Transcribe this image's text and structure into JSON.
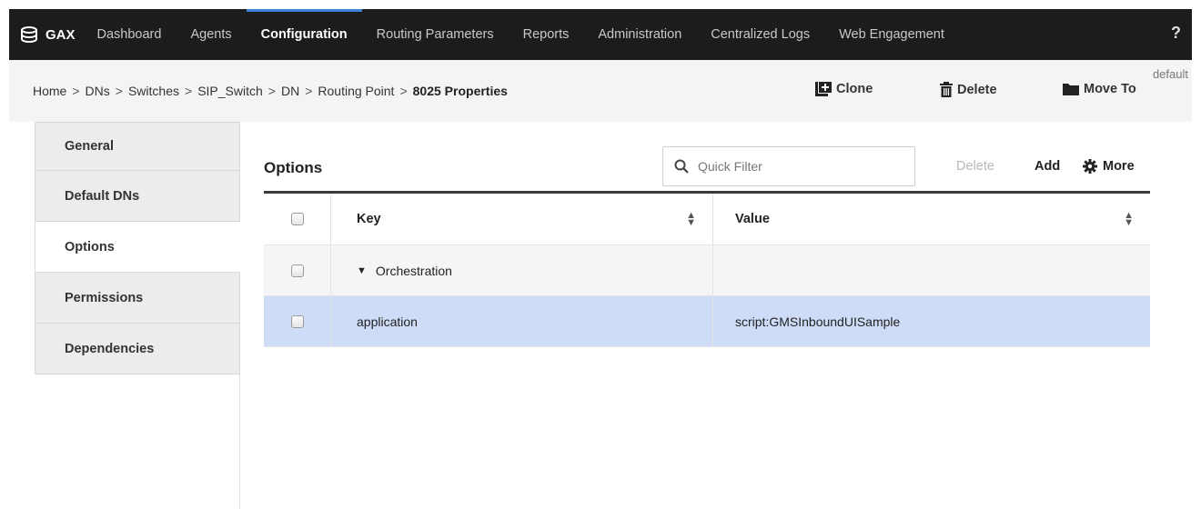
{
  "nav": {
    "brand": "GAX",
    "items": [
      {
        "label": "Dashboard"
      },
      {
        "label": "Agents"
      },
      {
        "label": "Configuration"
      },
      {
        "label": "Routing Parameters"
      },
      {
        "label": "Reports"
      },
      {
        "label": "Administration"
      },
      {
        "label": "Centralized Logs"
      },
      {
        "label": "Web Engagement"
      }
    ],
    "active": "Configuration",
    "help": "?"
  },
  "breadcrumb": {
    "items": [
      "Home",
      "DNs",
      "Switches",
      "SIP_Switch",
      "DN",
      "Routing Point",
      "8025 Properties"
    ],
    "separator": ">"
  },
  "tenant": "default",
  "actions": {
    "clone": "Clone",
    "delete": "Delete",
    "move_to": "Move To"
  },
  "tabs": [
    {
      "label": "General"
    },
    {
      "label": "Default DNs"
    },
    {
      "label": "Options"
    },
    {
      "label": "Permissions"
    },
    {
      "label": "Dependencies"
    }
  ],
  "active_tab": "Options",
  "options": {
    "title": "Options",
    "filter_placeholder": "Quick Filter",
    "delete_label": "Delete",
    "add_label": "Add",
    "more_label": "More",
    "columns": {
      "key": "Key",
      "value": "Value"
    },
    "rows": [
      {
        "type": "group",
        "key": "Orchestration",
        "value": ""
      },
      {
        "type": "option",
        "key": "application",
        "value": "script:GMSInboundUISample",
        "selected": true
      }
    ]
  },
  "colors": {
    "nav_bg": "#1c1c1c",
    "accent": "#3b82d6",
    "selected_row": "#cfdcf8"
  }
}
